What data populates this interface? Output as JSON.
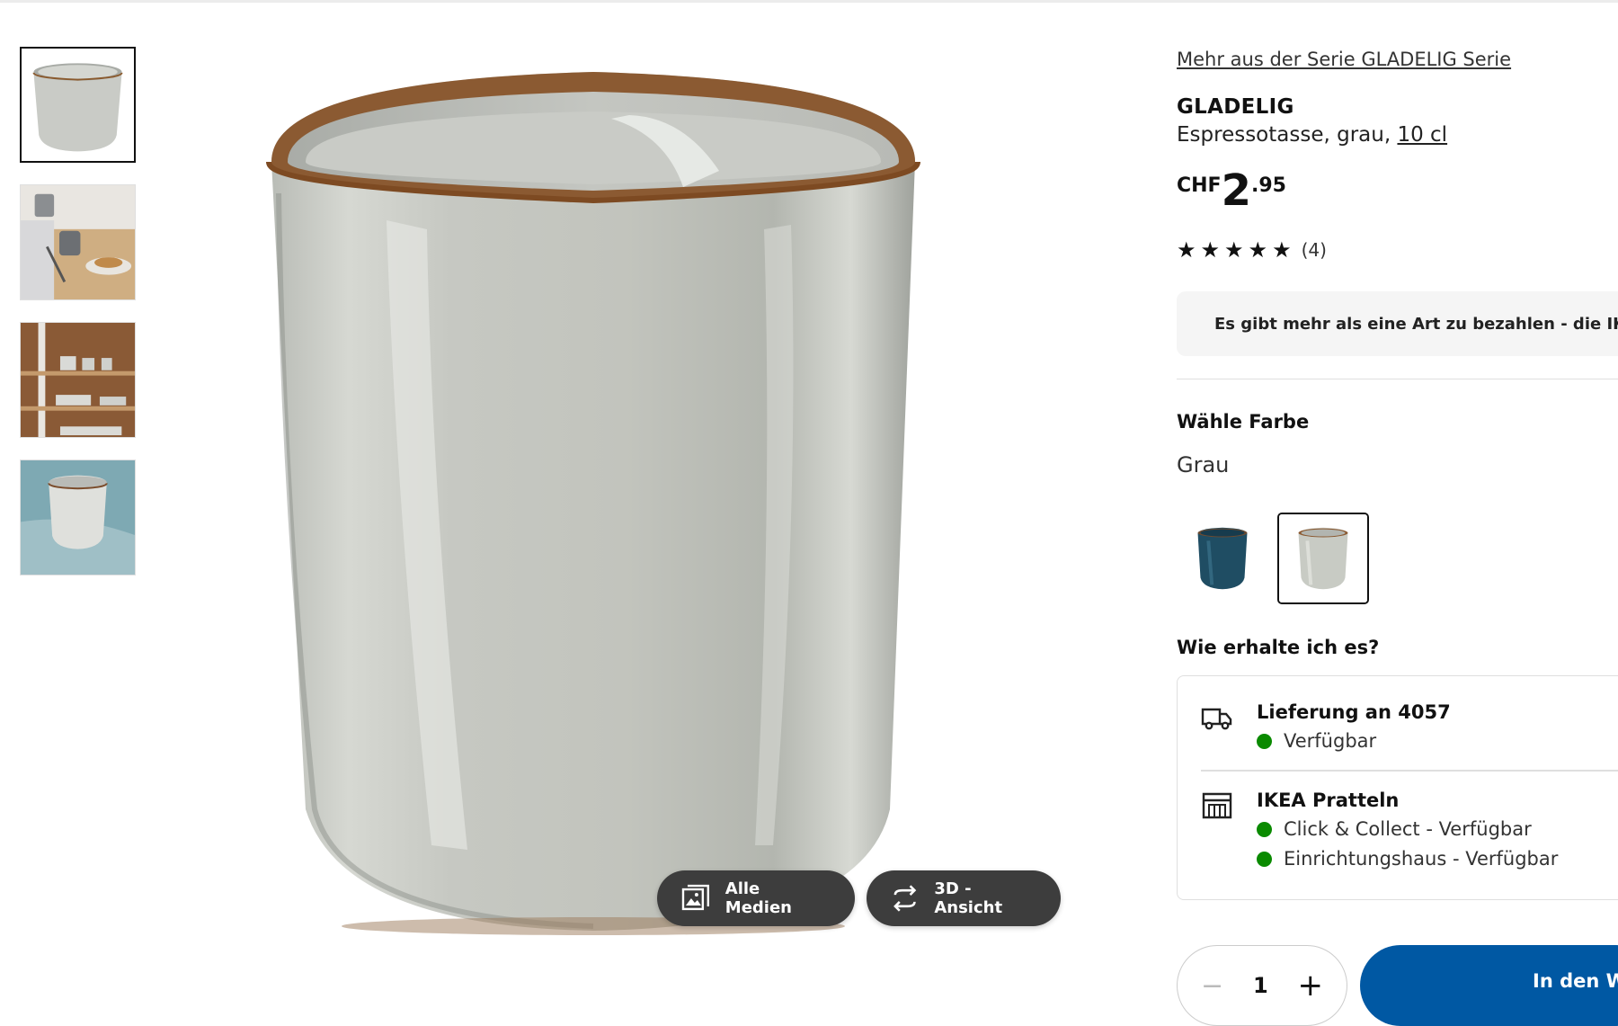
{
  "product": {
    "series_link": "Mehr aus der Serie GLADELIG Serie",
    "name": "GLADELIG",
    "description": "Espressotasse, grau, ",
    "size": "10 cl",
    "price": {
      "currency": "CHF",
      "integer": "2",
      "decimal": ".95"
    },
    "rating": {
      "stars": 5,
      "max": 5,
      "count": "(4)"
    }
  },
  "gallery": {
    "thumbnails": [
      {
        "alt": "GLADELIG Espressotasse grau",
        "active": true
      },
      {
        "alt": "Tasse auf Holztisch mit Brot",
        "active": false
      },
      {
        "alt": "Geschirr im Regal",
        "active": false
      },
      {
        "alt": "Tasse auf blauem Tuch",
        "active": false
      }
    ],
    "buttons": {
      "all_media": "Alle Medien",
      "view_3d": "3D -Ansicht"
    }
  },
  "payment_banner": {
    "text": "Es gibt mehr als eine Art zu bezahlen - die IKEA",
    "icon": "payment-icon"
  },
  "color": {
    "heading": "Wähle Farbe",
    "selected": "Grau",
    "swatches": [
      {
        "name": "Blau",
        "color": "#1f4d63",
        "selected": false
      },
      {
        "name": "Grau",
        "color": "#c8cbc4",
        "selected": true
      }
    ]
  },
  "delivery": {
    "heading": "Wie erhalte ich es?",
    "options": [
      {
        "title": "Lieferung an 4057",
        "icon": "truck-icon",
        "statuses": [
          "Verfügbar"
        ]
      },
      {
        "title": "IKEA Pratteln",
        "icon": "store-icon",
        "statuses": [
          "Click & Collect - Verfügbar",
          "Einrichtungshaus - Verfügbar"
        ]
      }
    ],
    "status_color": "#0a8a00"
  },
  "cart": {
    "quantity": "1",
    "minus": "−",
    "plus": "+",
    "add_label": "In den Warenkorb",
    "accent": "#0058a3"
  }
}
